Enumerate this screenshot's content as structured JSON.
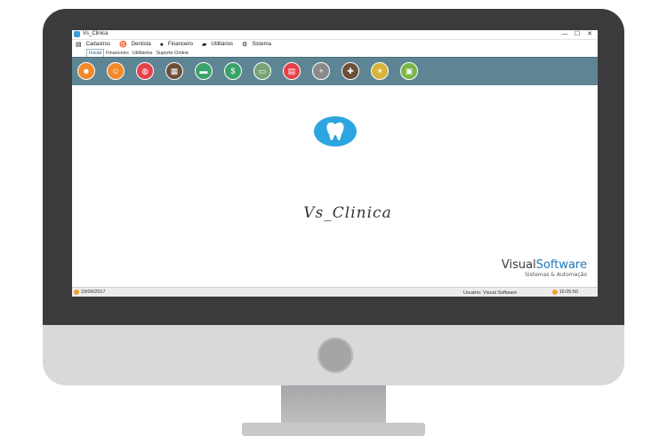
{
  "window": {
    "title": "Vs_Clinica",
    "controls": [
      "—",
      "☐",
      "✕"
    ]
  },
  "menu": [
    {
      "icon": "folder-icon",
      "glyph": "▤",
      "label": "Cadastros"
    },
    {
      "icon": "tooth-icon",
      "glyph": "♉",
      "label": "Dentista"
    },
    {
      "icon": "dollar-icon",
      "glyph": "●",
      "label": "Financeiro"
    },
    {
      "icon": "briefcase-icon",
      "glyph": "▰",
      "label": "Utilitários"
    },
    {
      "icon": "gears-icon",
      "glyph": "⚙",
      "label": "Sistema"
    }
  ],
  "ribbon_tabs": [
    "Inicial",
    "Financeiro",
    "Utilitários",
    "Suporte Online"
  ],
  "toolbar": {
    "buttons": [
      {
        "icon": "patients-icon",
        "color": "#f28a2a",
        "glyph": "☻"
      },
      {
        "icon": "dentist-icon",
        "color": "#f28a2a",
        "glyph": "☺"
      },
      {
        "icon": "globe-icon",
        "color": "#e6414b",
        "glyph": "◍"
      },
      {
        "icon": "calendar-icon",
        "color": "#6b4f3a",
        "glyph": "▦"
      },
      {
        "icon": "folder-icon",
        "color": "#3aa36a",
        "glyph": "▬"
      },
      {
        "icon": "money-bag-icon",
        "color": "#3aa36a",
        "glyph": "$"
      },
      {
        "icon": "cash-icon",
        "color": "#7aa37a",
        "glyph": "▭"
      },
      {
        "icon": "report-icon",
        "color": "#e6414b",
        "glyph": "▤"
      },
      {
        "icon": "add-icon",
        "color": "#8a8a8a",
        "glyph": "+"
      },
      {
        "icon": "medical-kit-icon",
        "color": "#6b4f3a",
        "glyph": "✚"
      },
      {
        "icon": "lightbulb-icon",
        "color": "#d9b23a",
        "glyph": "☀"
      },
      {
        "icon": "lock-icon",
        "color": "#7ab648",
        "glyph": "▣"
      }
    ]
  },
  "logo": {
    "text": "Vs_Clinica",
    "color": "#2da5e0"
  },
  "brand": {
    "name_part1": "Visual",
    "name_part2": "Software",
    "tagline": "Sistemas & Automação"
  },
  "status": {
    "date": "19/06/2017",
    "user": "Usuário: Visual Software",
    "time": "16:05:50"
  }
}
